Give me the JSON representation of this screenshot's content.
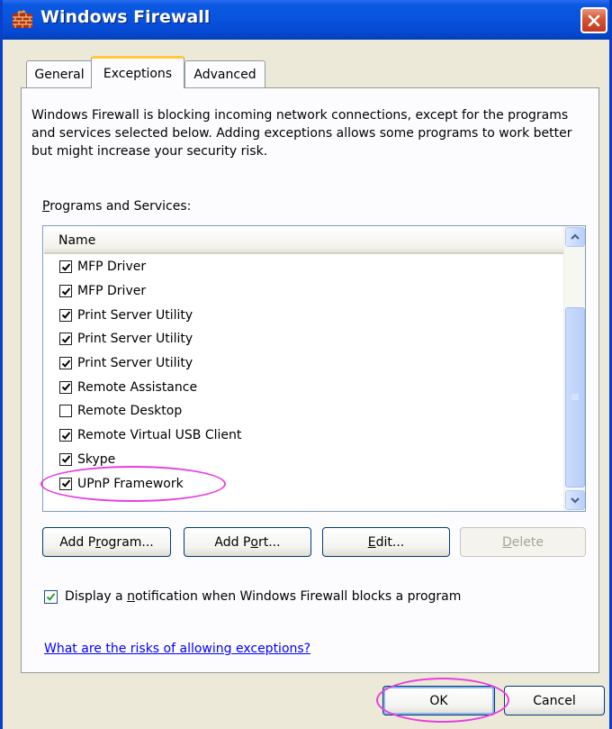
{
  "window": {
    "title": "Windows Firewall",
    "close_icon": "close-x-icon",
    "app_icon": "firewall-brick-wall-icon"
  },
  "tabs": [
    {
      "label": "General",
      "active": false
    },
    {
      "label": "Exceptions",
      "active": true
    },
    {
      "label": "Advanced",
      "active": false
    }
  ],
  "description": "Windows Firewall is blocking incoming network connections, except for the programs and services selected below. Adding exceptions allows some programs to work better but might increase your security risk.",
  "programs_label": {
    "pre": "",
    "key": "P",
    "post": "rograms and Services:"
  },
  "list": {
    "column_header": "Name",
    "items": [
      {
        "label": "MFP Driver",
        "checked": true
      },
      {
        "label": "MFP Driver",
        "checked": true
      },
      {
        "label": "Print Server Utility",
        "checked": true
      },
      {
        "label": "Print Server Utility",
        "checked": true
      },
      {
        "label": "Print Server Utility",
        "checked": true
      },
      {
        "label": "Remote Assistance",
        "checked": true
      },
      {
        "label": "Remote Desktop",
        "checked": false
      },
      {
        "label": "Remote Virtual USB Client",
        "checked": true
      },
      {
        "label": "Skype",
        "checked": true
      },
      {
        "label": "UPnP Framework",
        "checked": true
      }
    ]
  },
  "buttons": {
    "add_program": {
      "pre": "Add P",
      "key": "r",
      "post": "ogram..."
    },
    "add_port": {
      "pre": "Add P",
      "key": "o",
      "post": "rt..."
    },
    "edit": {
      "pre": "",
      "key": "E",
      "post": "dit..."
    },
    "delete": {
      "pre": "",
      "key": "D",
      "post": "elete"
    }
  },
  "notification": {
    "checked": true,
    "pre": "Display a ",
    "key": "n",
    "post": "otification when Windows Firewall blocks a program"
  },
  "risk_link": "What are the risks of allowing exceptions?",
  "dialog_buttons": {
    "ok": "OK",
    "cancel": "Cancel"
  },
  "colors": {
    "titlebar": "#0854e0",
    "highlight": "#e83ee2",
    "link": "#0000ff"
  }
}
